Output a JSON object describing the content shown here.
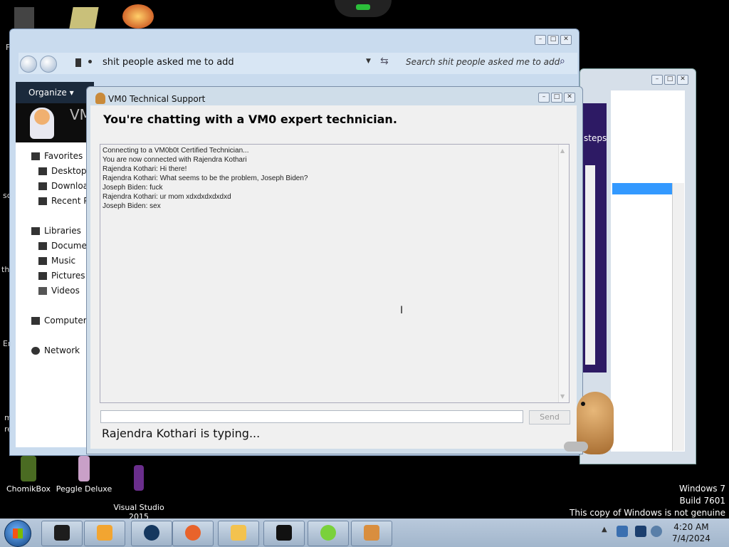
{
  "desktop": {
    "icons": [
      {
        "label": "ChomikBox",
        "color": "#4a6b22"
      },
      {
        "label": "Peggle Deluxe",
        "color": "#c9a0c8"
      },
      {
        "label": "Visual Studio\n2015",
        "color": "#6a2e8c"
      }
    ],
    "watermark": {
      "line1": "Windows 7",
      "line2": "Build 7601",
      "line3": "This copy of Windows is not genuine"
    }
  },
  "explorer": {
    "address": "shit people asked me to add",
    "search_placeholder": "Search shit people asked me to add",
    "organize": "Organize",
    "nav": {
      "favorites": "Favorites",
      "desktop": "Desktop",
      "downloads": "Downloa",
      "recent": "Recent P",
      "libraries": "Libraries",
      "documents": "Documer",
      "music": "Music",
      "pictures": "Pictures",
      "videos": "Videos",
      "computer": "Computer",
      "network": "Network"
    },
    "banner_text": "VM"
  },
  "bg_window": {
    "text": "steps"
  },
  "chat": {
    "window_title": "VM0 Technical Support",
    "heading": "You're chatting with a VM0 expert technician.",
    "messages": [
      "Connecting to a VM0b0t Certified Technician...",
      "You are now connected with Rajendra Kothari",
      "Rajendra Kothari: Hi there!",
      "Rajendra Kothari: What seems to be the problem, Joseph Biden?",
      "Joseph Biden: fuck",
      "Rajendra Kothari: ur mom xdxdxdxdxdxd",
      "Joseph Biden: sex"
    ],
    "input_value": "",
    "send_label": "Send",
    "typing_status": "Rajendra Kothari is typing..."
  },
  "taskbar": {
    "clock_time": "4:20 AM",
    "clock_date": "7/4/2024",
    "buttons": [
      {
        "name": "vm-app",
        "color": "#1d1d1d"
      },
      {
        "name": "media-player",
        "color": "#f2a531"
      },
      {
        "name": "globe-app",
        "color": "#15385f"
      },
      {
        "name": "firefox",
        "color": "#e8632b"
      },
      {
        "name": "explorer-folder",
        "color": "#f3c24e"
      },
      {
        "name": "terminal-app",
        "color": "#111111"
      },
      {
        "name": "lime-app",
        "color": "#7ad13b"
      },
      {
        "name": "tech-support-app",
        "color": "#d98e3e"
      }
    ]
  },
  "left_edge_fragments": [
    "F",
    "sc",
    "th",
    "Er",
    "m",
    "re"
  ]
}
